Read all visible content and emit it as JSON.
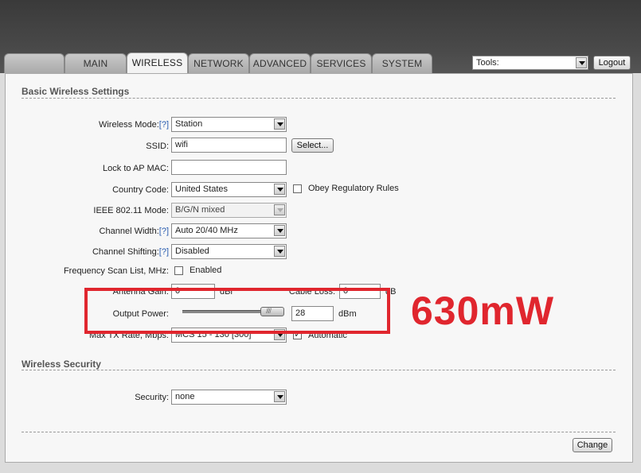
{
  "nav": {
    "tabs": [
      {
        "label": ""
      },
      {
        "label": "MAIN"
      },
      {
        "label": "WIRELESS"
      },
      {
        "label": "NETWORK"
      },
      {
        "label": "ADVANCED"
      },
      {
        "label": "SERVICES"
      },
      {
        "label": "SYSTEM"
      }
    ],
    "active_tab": "WIRELESS",
    "tools_value": "Tools:",
    "logout_label": "Logout"
  },
  "basic": {
    "title": "Basic Wireless Settings",
    "wireless_mode": {
      "label": "Wireless Mode:",
      "help": "[?]",
      "value": "Station"
    },
    "ssid": {
      "label": "SSID:",
      "value": "wifi",
      "select_label": "Select..."
    },
    "lock_ap": {
      "label": "Lock to AP MAC:",
      "value": ""
    },
    "country": {
      "label": "Country Code:",
      "value": "United States",
      "obey_label": "Obey Regulatory Rules"
    },
    "ieee": {
      "label": "IEEE 802.11 Mode:",
      "value": "B/G/N mixed"
    },
    "channel_width": {
      "label": "Channel Width:",
      "help": "[?]",
      "value": "Auto 20/40 MHz"
    },
    "channel_shifting": {
      "label": "Channel Shifting:",
      "help": "[?]",
      "value": "Disabled"
    },
    "freq_scan": {
      "label": "Frequency Scan List, MHz:",
      "enabled_label": "Enabled"
    },
    "antenna_gain": {
      "label": "Antenna Gain:",
      "value": "0",
      "unit": "dBi"
    },
    "cable_loss": {
      "label": "Cable Loss:",
      "value": "0",
      "unit": "dB"
    },
    "output_power": {
      "label": "Output Power:",
      "value": "28",
      "unit": "dBm",
      "slider_level": 0.97
    },
    "max_tx": {
      "label": "Max TX Rate, Mbps:",
      "value": "MCS 15 - 130 [300]",
      "auto_label": "Automatic"
    }
  },
  "security": {
    "title": "Wireless Security",
    "label": "Security:",
    "value": "none"
  },
  "actions": {
    "change_label": "Change"
  },
  "annotation": {
    "text": "630mW",
    "color": "#e0262e"
  }
}
